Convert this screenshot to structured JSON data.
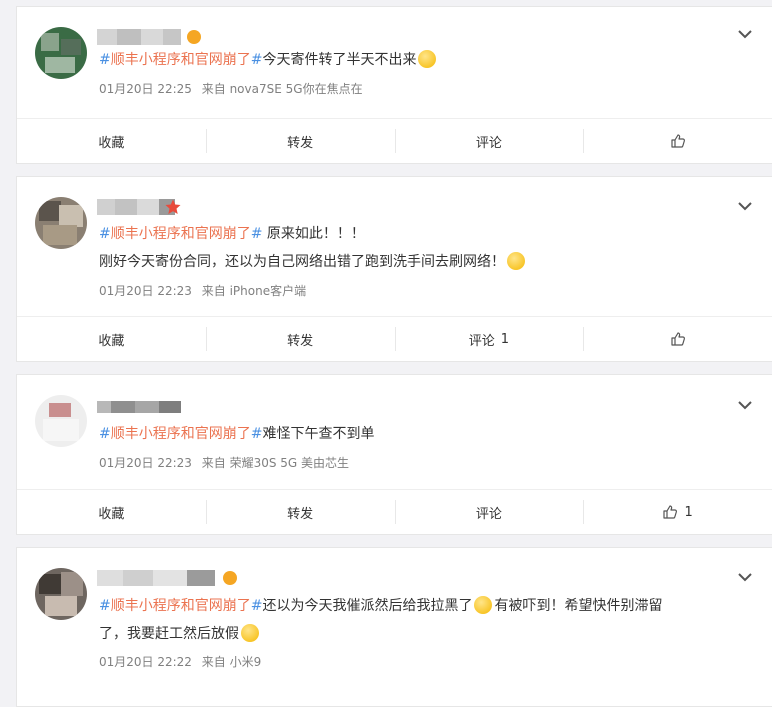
{
  "colors": {
    "topic": "#eb7350",
    "hash": "#4a90e2",
    "meta": "#808080"
  },
  "posts": [
    {
      "badge": "gold-medal-badge",
      "topic": "#顺丰小程序和官网崩了#",
      "line1": "今天寄件转了半天不出来",
      "line2": "",
      "time": "01月20日 22:25",
      "source": "来自 nova7SE 5G你在焦点在",
      "actions": {
        "fav": "收藏",
        "repost": "转发",
        "comment": "评论",
        "comment_count": "",
        "like_count": ""
      }
    },
    {
      "badge": "red-star-badge",
      "topic": "#顺丰小程序和官网崩了#",
      "line1": " 原来如此！！！",
      "line2": "刚好今天寄份合同，还以为自己网络出错了跑到洗手间去刷网络！",
      "time": "01月20日 22:23",
      "source": "来自 iPhone客户端",
      "actions": {
        "fav": "收藏",
        "repost": "转发",
        "comment": "评论",
        "comment_count": "1",
        "like_count": ""
      }
    },
    {
      "badge": "",
      "topic": "#顺丰小程序和官网崩了#",
      "line1": "难怪下午查不到单",
      "line2": "",
      "time": "01月20日 22:23",
      "source": "来自 荣耀30S 5G 美由芯生",
      "actions": {
        "fav": "收藏",
        "repost": "转发",
        "comment": "评论",
        "comment_count": "",
        "like_count": "1"
      }
    },
    {
      "badge": "gold-medal-badge",
      "topic": "#顺丰小程序和官网崩了#",
      "line1": "还以为今天我催派然后给我拉黑了",
      "line1b": "有被吓到！希望快件别滞留",
      "line2": "了，我要赶工然后放假",
      "time": "01月20日 22:22",
      "source": "来自 小米9",
      "actions": {
        "fav": "收藏",
        "repost": "转发",
        "comment": "评论",
        "comment_count": "",
        "like_count": ""
      }
    }
  ]
}
